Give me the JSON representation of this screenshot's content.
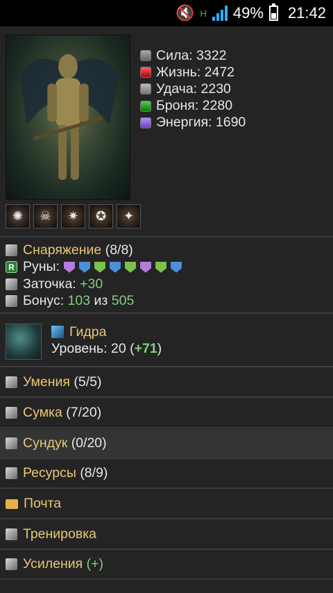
{
  "status_bar": {
    "battery_percent": "49%",
    "time": "21:42",
    "network_type": "H",
    "icons": [
      "mute-icon",
      "network-h-icon",
      "signal-icon",
      "battery-icon"
    ]
  },
  "character": {
    "stats": [
      {
        "icon": "strength-icon",
        "label": "Сила",
        "value": "3322"
      },
      {
        "icon": "life-icon",
        "label": "Жизнь",
        "value": "2472"
      },
      {
        "icon": "luck-icon",
        "label": "Удача",
        "value": "2230"
      },
      {
        "icon": "armor-icon",
        "label": "Броня",
        "value": "2280"
      },
      {
        "icon": "energy-icon",
        "label": "Энергия",
        "value": "1690"
      }
    ],
    "buffs": [
      "buff-1-icon",
      "buff-2-icon",
      "buff-3-icon",
      "buff-4-icon",
      "buff-5-icon"
    ]
  },
  "equipment": {
    "title": "Снаряжение",
    "count": "(8/8)",
    "runes_label": "Руны:",
    "runes": [
      {
        "color": "#b77ae0"
      },
      {
        "color": "#4a8fd8"
      },
      {
        "color": "#7ac24a"
      },
      {
        "color": "#4a8fd8"
      },
      {
        "color": "#7ac24a"
      },
      {
        "color": "#b77ae0"
      },
      {
        "color": "#7ac24a"
      },
      {
        "color": "#4a8fd8"
      }
    ],
    "sharpening_label": "Заточка:",
    "sharpening_value": "+30",
    "bonus_label": "Бонус:",
    "bonus_current": "103",
    "bonus_of": "из",
    "bonus_max": "505"
  },
  "pet": {
    "name": "Гидра",
    "level_label": "Уровень:",
    "level_value": "20",
    "level_bonus": "+71"
  },
  "menu": [
    {
      "label": "Умения",
      "count": "(5/5)",
      "icon": "skills-icon"
    },
    {
      "label": "Сумка",
      "count": "(7/20)",
      "icon": "bag-icon"
    },
    {
      "label": "Сундук",
      "count": "(0/20)",
      "icon": "chest-icon"
    },
    {
      "label": "Ресурсы",
      "count": "(8/9)",
      "icon": "resources-icon"
    },
    {
      "label": "Почта",
      "count": "",
      "icon": "mail-icon"
    },
    {
      "label": "Тренировка",
      "count": "",
      "icon": "training-icon"
    },
    {
      "label": "Усиления",
      "count": "(+)",
      "icon": "boosts-icon"
    }
  ],
  "colors": {
    "accent_gold": "#e9c774",
    "accent_green": "#7fd07f",
    "background": "#242424"
  }
}
